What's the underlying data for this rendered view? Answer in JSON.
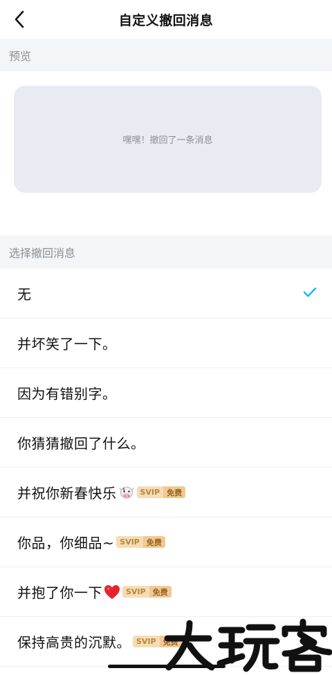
{
  "nav": {
    "title": "自定义撤回消息",
    "back_icon": "chevron-left-icon"
  },
  "sections": {
    "preview": "预览",
    "select": "选择撤回消息"
  },
  "preview": {
    "text": "嘿嘿！撤回了一条消息"
  },
  "badge": {
    "part1": "SVIP",
    "part2": "免费"
  },
  "options": [
    {
      "text": "无",
      "selected": true
    },
    {
      "text": "并坏笑了一下。"
    },
    {
      "text": "因为有错别字。"
    },
    {
      "text": "你猜猜撤回了什么。"
    },
    {
      "text": "并祝你新春快乐",
      "emoji": "cow-face-icon",
      "svip": true
    },
    {
      "text": "你品，你细品~",
      "svip": true
    },
    {
      "text": "并抱了你一下",
      "emoji": "red-heart-icon",
      "svip": true
    },
    {
      "text": "保持高贵的沉默。",
      "svip": true
    }
  ],
  "colors": {
    "accent": "#12b7f5",
    "section_bg": "#f4f5f7",
    "bubble_bg": "#e9ebf2",
    "svip_light": "#f6dcb4",
    "svip_dark": "#f0c994"
  },
  "watermark": {
    "text": "大玩客"
  }
}
